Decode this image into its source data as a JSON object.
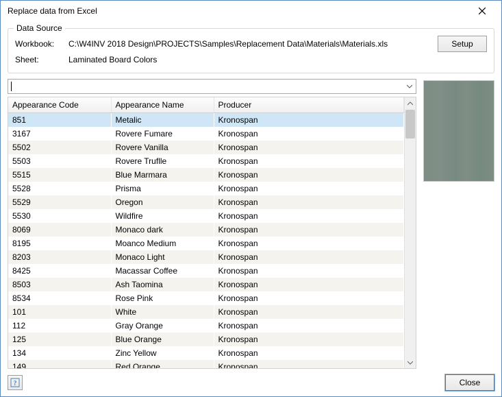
{
  "window": {
    "title": "Replace data from Excel"
  },
  "dataSource": {
    "legend": "Data Source",
    "workbookLabel": "Workbook:",
    "workbookValue": "C:\\W4INV 2018 Design\\PROJECTS\\Samples\\Replacement Data\\Materials\\Materials.xls",
    "sheetLabel": "Sheet:",
    "sheetValue": "Laminated Board Colors",
    "setupLabel": "Setup"
  },
  "search": {
    "value": "",
    "placeholder": ""
  },
  "table": {
    "headers": {
      "code": "Appearance Code",
      "name": "Appearance Name",
      "producer": "Producer"
    },
    "rows": [
      {
        "code": "851",
        "name": "Metalic",
        "producer": "Kronospan"
      },
      {
        "code": "3167",
        "name": "Rovere Fumare",
        "producer": "Kronospan"
      },
      {
        "code": "5502",
        "name": "Rovere Vanilla",
        "producer": "Kronospan"
      },
      {
        "code": "5503",
        "name": "Rovere Truflle",
        "producer": "Kronospan"
      },
      {
        "code": "5515",
        "name": "Blue Marmara",
        "producer": "Kronospan"
      },
      {
        "code": "5528",
        "name": "Prisma",
        "producer": "Kronospan"
      },
      {
        "code": "5529",
        "name": "Oregon",
        "producer": "Kronospan"
      },
      {
        "code": "5530",
        "name": "Wildfire",
        "producer": "Kronospan"
      },
      {
        "code": "8069",
        "name": "Monaco dark",
        "producer": "Kronospan"
      },
      {
        "code": "8195",
        "name": "Moanco Medium",
        "producer": "Kronospan"
      },
      {
        "code": "8203",
        "name": "Monaco Light",
        "producer": "Kronospan"
      },
      {
        "code": "8425",
        "name": "Macassar Coffee",
        "producer": "Kronospan"
      },
      {
        "code": "8503",
        "name": "Ash Taomina",
        "producer": "Kronospan"
      },
      {
        "code": "8534",
        "name": "Rose Pink",
        "producer": "Kronospan"
      },
      {
        "code": "101",
        "name": "White",
        "producer": "Kronospan"
      },
      {
        "code": "112",
        "name": "Gray Orange",
        "producer": "Kronospan"
      },
      {
        "code": "125",
        "name": "Blue Orange",
        "producer": "Kronospan"
      },
      {
        "code": "134",
        "name": "Zinc Yellow",
        "producer": "Kronospan"
      },
      {
        "code": "149",
        "name": "Red Orange",
        "producer": "Kronospan"
      }
    ],
    "selectedIndex": 0
  },
  "footer": {
    "closeLabel": "Close"
  }
}
